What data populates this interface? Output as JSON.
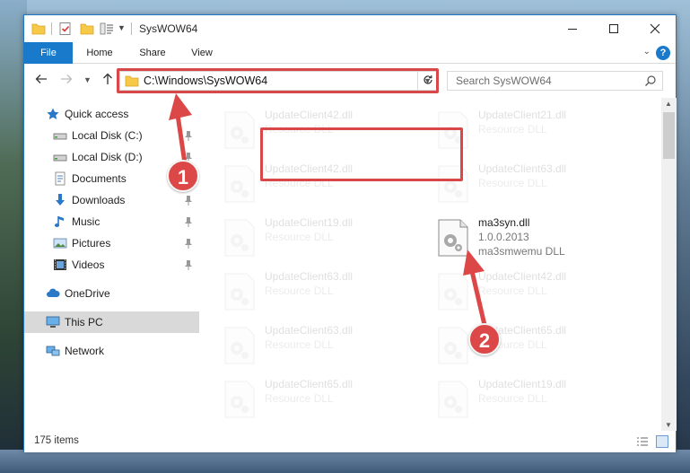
{
  "window": {
    "title": "SysWOW64"
  },
  "ribbon": {
    "tabs": [
      "File",
      "Home",
      "Share",
      "View"
    ],
    "help": "?"
  },
  "nav": {
    "address": "C:\\Windows\\SysWOW64",
    "search_placeholder": "Search SysWOW64"
  },
  "sidebar": {
    "items": [
      {
        "label": "Quick access",
        "icon": "star-icon",
        "pinned": false
      },
      {
        "label": "Local Disk (C:)",
        "icon": "drive-icon",
        "pinned": true
      },
      {
        "label": "Local Disk (D:)",
        "icon": "drive-icon",
        "pinned": true
      },
      {
        "label": "Documents",
        "icon": "documents-icon",
        "pinned": true
      },
      {
        "label": "Downloads",
        "icon": "download-icon",
        "pinned": true
      },
      {
        "label": "Music",
        "icon": "music-icon",
        "pinned": true
      },
      {
        "label": "Pictures",
        "icon": "pictures-icon",
        "pinned": true
      },
      {
        "label": "Videos",
        "icon": "videos-icon",
        "pinned": true
      },
      {
        "label": "OneDrive",
        "icon": "cloud-icon",
        "pinned": false
      },
      {
        "label": "This PC",
        "icon": "computer-icon",
        "pinned": false,
        "selected": true
      },
      {
        "label": "Network",
        "icon": "network-icon",
        "pinned": false
      }
    ]
  },
  "files": [
    {
      "name": "UpdateClient42.dll",
      "line2": "Resource DLL",
      "line3": "",
      "faded": true
    },
    {
      "name": "UpdateClient21.dll",
      "line2": "Resource DLL",
      "line3": "",
      "faded": true
    },
    {
      "name": "UpdateClient42.dll",
      "line2": "Resource DLL",
      "line3": "",
      "faded": true
    },
    {
      "name": "UpdateClient63.dll",
      "line2": "Resource DLL",
      "line3": "",
      "faded": true
    },
    {
      "name": "UpdateClient19.dll",
      "line2": "Resource DLL",
      "line3": "",
      "faded": true
    },
    {
      "name": "ma3syn.dll",
      "line2": "1.0.0.2013",
      "line3": "ma3smwemu DLL",
      "faded": false
    },
    {
      "name": "UpdateClient63.dll",
      "line2": "Resource DLL",
      "line3": "",
      "faded": true
    },
    {
      "name": "UpdateClient42.dll",
      "line2": "Resource DLL",
      "line3": "",
      "faded": true
    },
    {
      "name": "UpdateClient63.dll",
      "line2": "Resource DLL",
      "line3": "",
      "faded": true
    },
    {
      "name": "UpdateClient65.dll",
      "line2": "Resource DLL",
      "line3": "",
      "faded": true
    },
    {
      "name": "UpdateClient65.dll",
      "line2": "Resource DLL",
      "line3": "",
      "faded": true
    },
    {
      "name": "UpdateClient19.dll",
      "line2": "Resource DLL",
      "line3": "",
      "faded": true
    }
  ],
  "status": {
    "item_count": "175 items"
  },
  "annotations": {
    "step1": "1",
    "step2": "2",
    "color": "#dc4848"
  },
  "colors": {
    "accent": "#1979ca",
    "highlight": "#d84848",
    "selected_bg": "#d9d9d9"
  }
}
